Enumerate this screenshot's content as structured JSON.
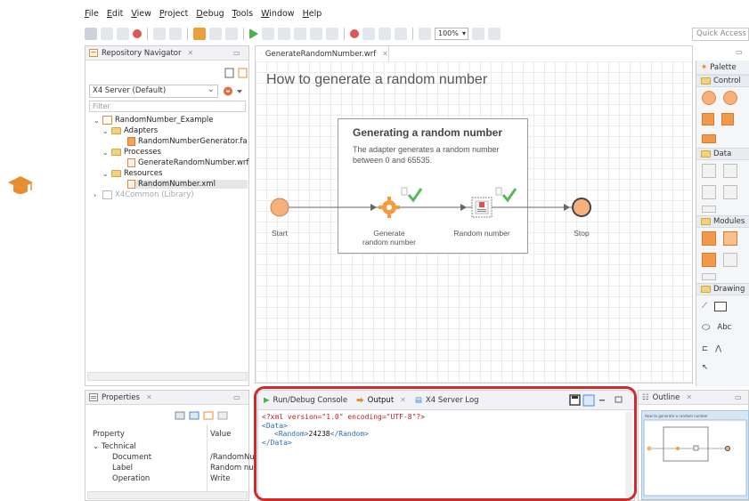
{
  "menu": [
    "File",
    "Edit",
    "View",
    "Project",
    "Debug",
    "Tools",
    "Window",
    "Help"
  ],
  "toolbar": {
    "zoom": "100%",
    "quick_access": "Quick Access"
  },
  "navigator": {
    "title": "Repository Navigator",
    "server": "X4 Server (Default)",
    "filter_placeholder": "Filter",
    "tree": [
      {
        "label": "RandomNumber_Example"
      },
      {
        "label": "Adapters"
      },
      {
        "label": "RandomNumberGenerator.fa"
      },
      {
        "label": "Processes"
      },
      {
        "label": "GenerateRandomNumber.wrf"
      },
      {
        "label": "Resources"
      },
      {
        "label": "RandomNumber.xml"
      },
      {
        "label": "X4Common (Library)"
      }
    ]
  },
  "editor": {
    "tab": "GenerateRandomNumber.wrf",
    "diagram_title": "How to generate a random number",
    "box_title": "Generating a random number",
    "box_desc": "The adapter generates a random number between 0 and 65535.",
    "nodes": {
      "start": "Start",
      "generate": "Generate random number",
      "random": "Random number",
      "stop": "Stop"
    }
  },
  "palette": {
    "title": "Palette",
    "sections": {
      "control": "Control",
      "data": "Data",
      "modules": "Modules",
      "drawing": "Drawing"
    },
    "abc": "Abc"
  },
  "properties": {
    "title": "Properties",
    "col_property": "Property",
    "col_value": "Value",
    "group": "Technical",
    "rows": [
      {
        "name": "Document",
        "value": "/RandomNu"
      },
      {
        "name": "Label",
        "value": "Random nu"
      },
      {
        "name": "Operation",
        "value": "Write"
      }
    ]
  },
  "output": {
    "tabs": {
      "console": "Run/Debug Console",
      "output": "Output",
      "log": "X4 Server Log"
    },
    "lines": {
      "decl": "<?xml version=\"1.0\" encoding=\"UTF-8\"?>",
      "open": "<Data>",
      "random_open": "<Random>",
      "random_value": "24238",
      "random_close": "</Random>",
      "close": "</Data>"
    }
  },
  "outline": {
    "title": "Outline",
    "mini_title": "How to generate a random number"
  },
  "colors": {
    "highlight": "#d12a2a",
    "node_fill": "#f6b07c",
    "accent_orange": "#e98b2f",
    "check_green": "#5cb85c"
  }
}
